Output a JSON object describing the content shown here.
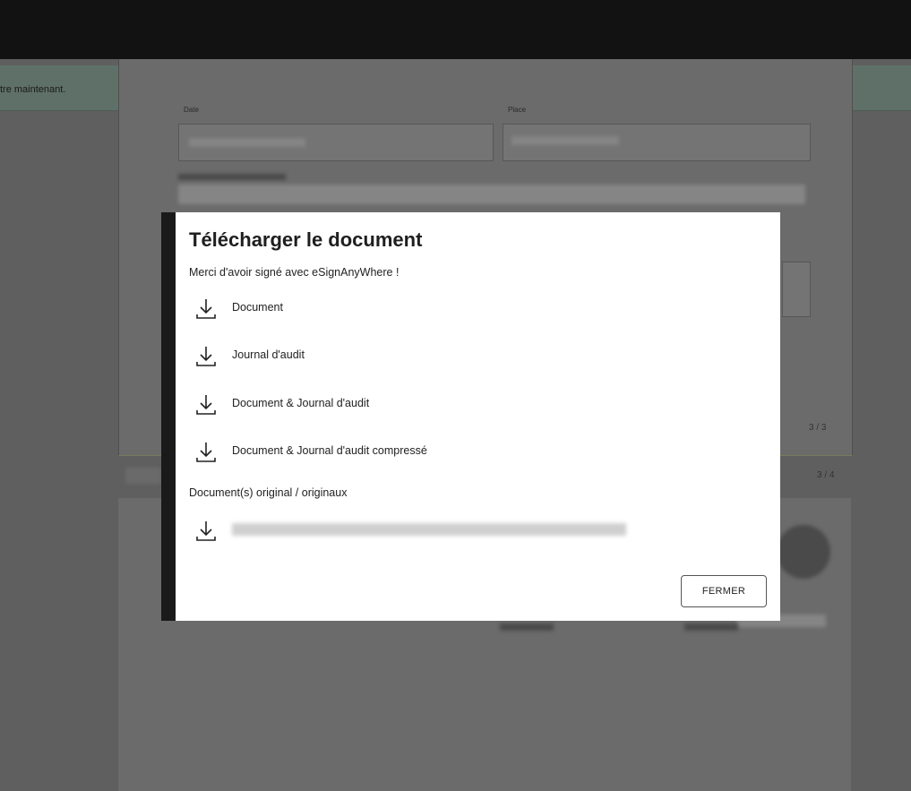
{
  "notice": {
    "text": "tre maintenant."
  },
  "background_form": {
    "date_label": "Date",
    "place_label": "Place",
    "page_counter_1": "3 / 3",
    "page_counter_2": "3 / 4"
  },
  "dialog": {
    "title": "Télécharger le document",
    "subtitle": "Merci d'avoir signé avec eSignAnyWhere !",
    "downloads": [
      {
        "label": "Document",
        "icon": "download-icon"
      },
      {
        "label": "Journal d'audit",
        "icon": "download-icon"
      },
      {
        "label": "Document & Journal d'audit",
        "icon": "download-icon"
      },
      {
        "label": "Document & Journal d'audit compressé",
        "icon": "download-icon"
      }
    ],
    "originals_label": "Document(s) original / originaux",
    "original_file_icon": "download-icon",
    "close_label": "FERMER"
  },
  "colors": {
    "overlay": "#5f5f5f",
    "topbar": "#121212",
    "notice_bar": "#5f7068",
    "dialog_bg": "#ffffff",
    "text": "#222222"
  }
}
